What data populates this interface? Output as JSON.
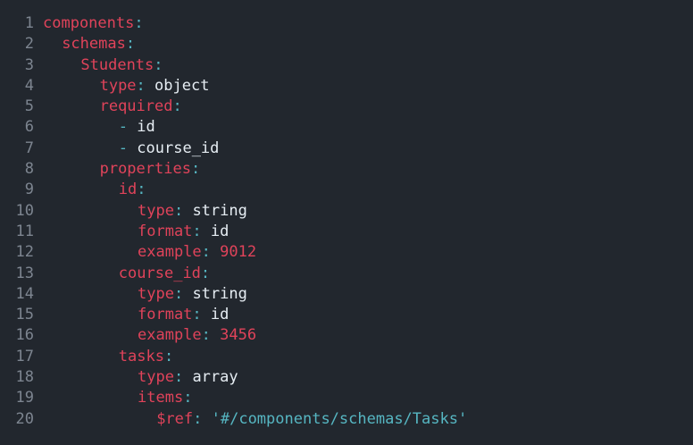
{
  "lines": [
    {
      "num": "1",
      "indent": 0,
      "key": "components",
      "colon": ":",
      "value": "",
      "type": "key"
    },
    {
      "num": "2",
      "indent": 1,
      "key": "schemas",
      "colon": ":",
      "value": "",
      "type": "key"
    },
    {
      "num": "3",
      "indent": 2,
      "key": "Students",
      "colon": ":",
      "value": "",
      "type": "key"
    },
    {
      "num": "4",
      "indent": 3,
      "key": "type",
      "colon": ":",
      "value": " object",
      "type": "kv"
    },
    {
      "num": "5",
      "indent": 3,
      "key": "required",
      "colon": ":",
      "value": "",
      "type": "key"
    },
    {
      "num": "6",
      "indent": 4,
      "dash": "-",
      "value": " id",
      "type": "item"
    },
    {
      "num": "7",
      "indent": 4,
      "dash": "-",
      "value": " course_id",
      "type": "item"
    },
    {
      "num": "8",
      "indent": 3,
      "key": "properties",
      "colon": ":",
      "value": "",
      "type": "key"
    },
    {
      "num": "9",
      "indent": 4,
      "key": "id",
      "colon": ":",
      "value": "",
      "type": "key"
    },
    {
      "num": "10",
      "indent": 5,
      "key": "type",
      "colon": ":",
      "value": " string",
      "type": "kv"
    },
    {
      "num": "11",
      "indent": 5,
      "key": "format",
      "colon": ":",
      "value": " id",
      "type": "kv"
    },
    {
      "num": "12",
      "indent": 5,
      "key": "example",
      "colon": ":",
      "value": " 9012",
      "type": "num"
    },
    {
      "num": "13",
      "indent": 4,
      "key": "course_id",
      "colon": ":",
      "value": "",
      "type": "key"
    },
    {
      "num": "14",
      "indent": 5,
      "key": "type",
      "colon": ":",
      "value": " string",
      "type": "kv"
    },
    {
      "num": "15",
      "indent": 5,
      "key": "format",
      "colon": ":",
      "value": " id",
      "type": "kv"
    },
    {
      "num": "16",
      "indent": 5,
      "key": "example",
      "colon": ":",
      "value": " 3456",
      "type": "num"
    },
    {
      "num": "17",
      "indent": 4,
      "key": "tasks",
      "colon": ":",
      "value": "",
      "type": "key"
    },
    {
      "num": "18",
      "indent": 5,
      "key": "type",
      "colon": ":",
      "value": " array",
      "type": "kv"
    },
    {
      "num": "19",
      "indent": 5,
      "key": "items",
      "colon": ":",
      "value": "",
      "type": "key"
    },
    {
      "num": "20",
      "indent": 6,
      "key": "$ref",
      "colon": ":",
      "value": " '#/components/schemas/Tasks'",
      "type": "str"
    }
  ],
  "colors": {
    "background": "#22272e",
    "line_number": "#7d8590",
    "key": "#e0435a",
    "punctuation": "#56b6c2",
    "value": "#e6edf3",
    "number": "#e0435a",
    "string": "#56b6c2"
  }
}
